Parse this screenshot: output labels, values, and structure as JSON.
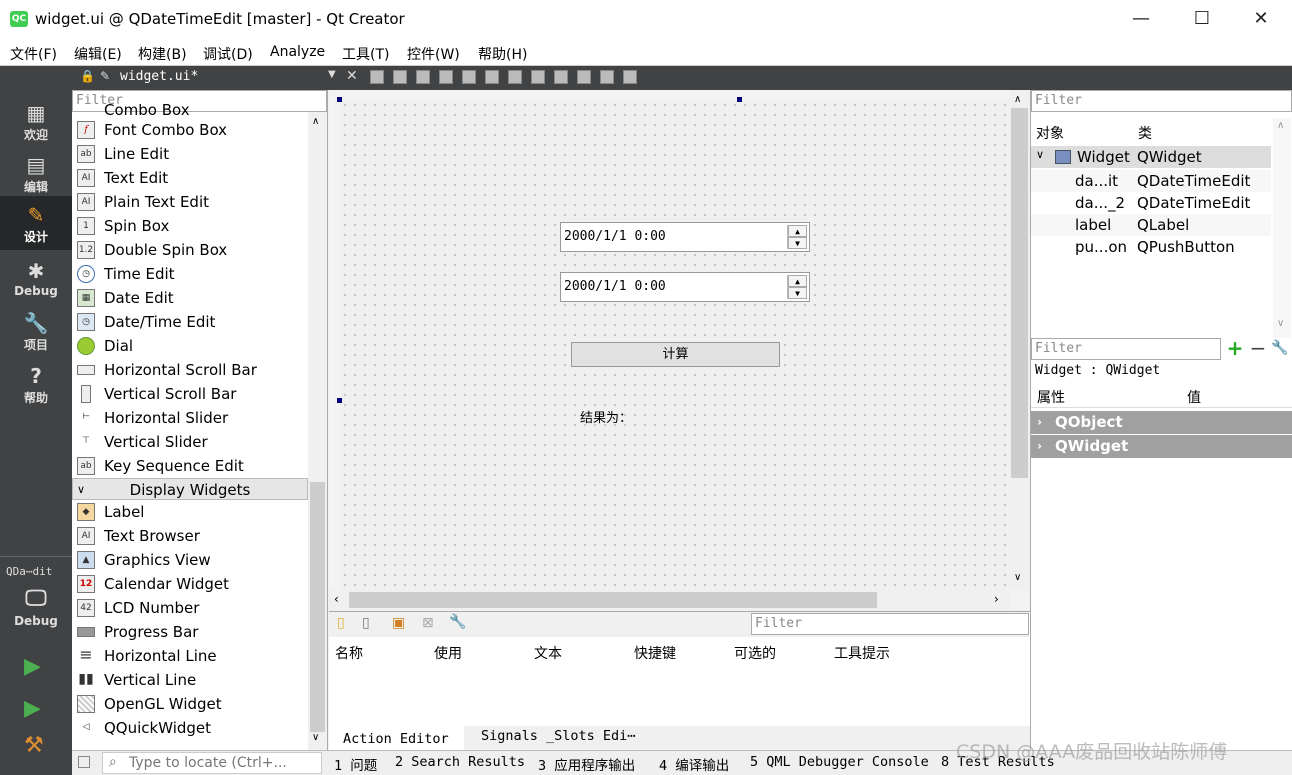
{
  "window": {
    "title": "widget.ui @ QDateTimeEdit [master] - Qt Creator",
    "logo": "QC",
    "minimize": "—",
    "maximize": "☐",
    "close": "✕"
  },
  "menu": [
    "文件(F)",
    "编辑(E)",
    "构建(B)",
    "调试(D)",
    "Analyze",
    "工具(T)",
    "控件(W)",
    "帮助(H)"
  ],
  "modes": [
    {
      "label": "欢迎",
      "icon": "grid-icon"
    },
    {
      "label": "编辑",
      "icon": "document-icon"
    },
    {
      "label": "设计",
      "icon": "pencil-icon"
    },
    {
      "label": "Debug",
      "icon": "bug-icon"
    },
    {
      "label": "项目",
      "icon": "wrench-icon"
    },
    {
      "label": "帮助",
      "icon": "help-icon"
    }
  ],
  "kit": {
    "name": "QDa⋯dit",
    "mode": "Debug"
  },
  "doc_tab": {
    "name": "widget.ui*"
  },
  "widgetbox": {
    "filter_placeholder": "Filter",
    "top_cut_item": "Combo Box",
    "input_items": [
      "Font Combo Box",
      "Line Edit",
      "Text Edit",
      "Plain Text Edit",
      "Spin Box",
      "Double Spin Box",
      "Time Edit",
      "Date Edit",
      "Date/Time Edit",
      "Dial",
      "Horizontal Scroll Bar",
      "Vertical Scroll Bar",
      "Horizontal Slider",
      "Vertical Slider",
      "Key Sequence Edit"
    ],
    "display_category": "Display Widgets",
    "display_items": [
      "Label",
      "Text Browser",
      "Graphics View",
      "Calendar Widget",
      "LCD Number",
      "Progress Bar",
      "Horizontal Line",
      "Vertical Line",
      "OpenGL Widget",
      "QQuickWidget"
    ]
  },
  "form": {
    "datetime1": "2000/1/1 0:00",
    "datetime2": "2000/1/1 0:00",
    "button": "计算",
    "result_label": "结果为："
  },
  "action_editor": {
    "filter_placeholder": "Filter",
    "columns": [
      "名称",
      "使用",
      "文本",
      "快捷键",
      "可选的",
      "工具提示"
    ],
    "tabs": [
      "Action Editor",
      "Signals _Slots Edi⋯"
    ]
  },
  "object_inspector": {
    "filter_placeholder": "Filter",
    "columns": [
      "对象",
      "类"
    ],
    "root": {
      "name": "Widget",
      "class": "QWidget"
    },
    "children": [
      {
        "name": "da...it",
        "class": "QDateTimeEdit"
      },
      {
        "name": "da..._2",
        "class": "QDateTimeEdit"
      },
      {
        "name": "label",
        "class": "QLabel"
      },
      {
        "name": "pu...on",
        "class": "QPushButton"
      }
    ]
  },
  "property_editor": {
    "filter_placeholder": "Filter",
    "context": "Widget : QWidget",
    "columns": [
      "属性",
      "值"
    ],
    "groups": [
      "QObject",
      "QWidget"
    ]
  },
  "statusbar": {
    "locator_placeholder": "Type to locate (Ctrl+...",
    "panes": [
      "1 问题",
      "2 Search Results",
      "3 应用程序输出",
      "4 编译输出",
      "5 QML Debugger Console",
      "8 Test Results"
    ]
  },
  "watermark": "CSDN @AAA废品回收站陈师傅"
}
